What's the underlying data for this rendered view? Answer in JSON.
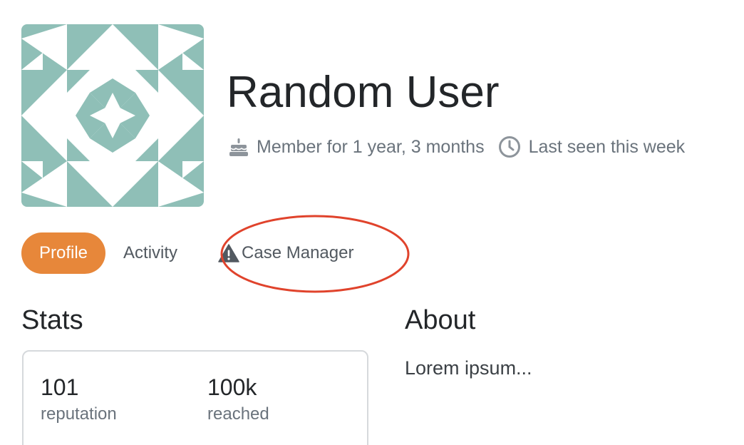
{
  "profile": {
    "name": "Random User",
    "member_since": "Member for 1 year, 3 months",
    "last_seen": "Last seen this week",
    "avatar_color": "#8fbfb7"
  },
  "icons": {
    "member_since": "birthday-cake-icon",
    "last_seen": "clock-icon",
    "case_manager": "warning-triangle-icon"
  },
  "tabs": [
    {
      "label": "Profile",
      "active": true
    },
    {
      "label": "Activity",
      "active": false
    },
    {
      "label": "Case Manager",
      "active": false
    }
  ],
  "colors": {
    "accent": "#e7873a",
    "annotation": "#e0432c",
    "muted_text": "#6a737c"
  },
  "stats": {
    "title": "Stats",
    "items": [
      {
        "value": "101",
        "label": "reputation"
      },
      {
        "value": "100k",
        "label": "reached"
      }
    ]
  },
  "about": {
    "title": "About",
    "text": "Lorem ipsum..."
  }
}
